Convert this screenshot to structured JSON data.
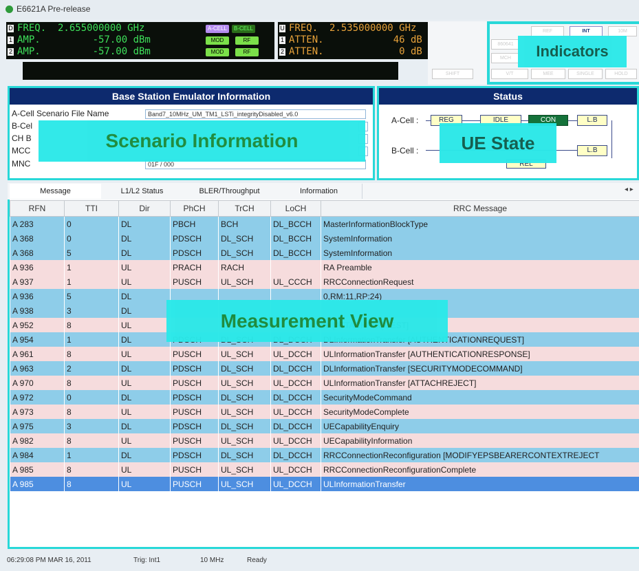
{
  "window": {
    "title": "E6621A Pre-release"
  },
  "led_left": {
    "rows": [
      {
        "index": "D",
        "text": "FREQ.  2.655000000 GHz"
      },
      {
        "index": "1",
        "text": "AMP.         -57.00 dBm"
      },
      {
        "index": "2",
        "text": "AMP.         -57.00 dBm"
      }
    ],
    "buttons": {
      "acell": "A-CELL",
      "bcell": "B-CELL",
      "mod1": "MOD",
      "rf1": "RF",
      "mod2": "MOD",
      "rf2": "RF"
    }
  },
  "led_right": {
    "rows": [
      {
        "index": "U",
        "text": "FREQ.  2.535000000 GHz"
      },
      {
        "index": "1",
        "text": "ATTEN.            46 dB"
      },
      {
        "index": "2",
        "text": "ATTEN.             0 dB"
      }
    ]
  },
  "indicators": {
    "items": [
      "REF",
      "INT",
      "10M",
      "860641",
      "MCH",
      "SHIFT",
      "V/T",
      "MEE",
      "SINGLE",
      "HOLD"
    ],
    "overlay_label": "Indicators"
  },
  "bse": {
    "title": "Base Station Emulator Information",
    "overlay_label": "Scenario Information",
    "labels": {
      "acell_file": "A-Cell Scenario File Name",
      "bcell_file": "B-Cel",
      "ch": "CH B",
      "mcc": "MCC",
      "mnc": "MNC"
    },
    "values": {
      "acell_file": "Band7_10MHz_UM_TM1_LSTi_integrityDisabled_v6.0",
      "mnc": "01F / 000"
    }
  },
  "status_panel": {
    "title": "Status",
    "overlay_label": "UE State",
    "acell_label": "A-Cell :",
    "bcell_label": "B-Cell :",
    "states": {
      "reg": "REG",
      "idle": "IDLE",
      "con": "CON",
      "lb_a": "L.B",
      "lb_b": "L.B",
      "rel": "REL"
    }
  },
  "tabs": [
    "Message",
    "L1/L2 Status",
    "BLER/Throughput",
    "Information"
  ],
  "scroll_arrows": "◂ ▸",
  "table": {
    "headers": [
      "RFN",
      "TTI",
      "Dir",
      "PhCH",
      "TrCH",
      "LoCH",
      "RRC Message"
    ],
    "rows": [
      [
        "A 283",
        "0",
        "DL",
        "PBCH",
        "BCH",
        "DL_BCCH",
        "MasterInformationBlockType"
      ],
      [
        "A 368",
        "0",
        "DL",
        "PDSCH",
        "DL_SCH",
        "DL_BCCH",
        "SystemInformation"
      ],
      [
        "A 368",
        "5",
        "DL",
        "PDSCH",
        "DL_SCH",
        "DL_BCCH",
        "SystemInformation"
      ],
      [
        "A 936",
        "1",
        "UL",
        "PRACH",
        "RACH",
        "",
        "RA Preamble"
      ],
      [
        "A 937",
        "1",
        "UL",
        "PUSCH",
        "UL_SCH",
        "UL_CCCH",
        "RRCConnectionRequest"
      ],
      [
        "A 936",
        "5",
        "DL",
        "",
        "",
        "",
        "0,RM:11,RP:24)"
      ],
      [
        "A 938",
        "3",
        "DL",
        "",
        "",
        "",
        ""
      ],
      [
        "A 952",
        "8",
        "UL",
        "",
        "",
        "",
        "te [ATTACHREQUEST]"
      ],
      [
        "A 954",
        "1",
        "DL",
        "PDSCH",
        "DL_SCH",
        "DL_DCCH",
        "DLInformationTransfer [AUTHENTICATIONREQUEST]"
      ],
      [
        "A 961",
        "8",
        "UL",
        "PUSCH",
        "UL_SCH",
        "UL_DCCH",
        "ULInformationTransfer [AUTHENTICATIONRESPONSE]"
      ],
      [
        "A 963",
        "2",
        "DL",
        "PDSCH",
        "DL_SCH",
        "DL_DCCH",
        "DLInformationTransfer [SECURITYMODECOMMAND]"
      ],
      [
        "A 970",
        "8",
        "UL",
        "PUSCH",
        "UL_SCH",
        "UL_DCCH",
        "ULInformationTransfer [ATTACHREJECT]"
      ],
      [
        "A 972",
        "0",
        "DL",
        "PDSCH",
        "DL_SCH",
        "DL_DCCH",
        "SecurityModeCommand"
      ],
      [
        "A 973",
        "8",
        "UL",
        "PUSCH",
        "UL_SCH",
        "UL_DCCH",
        "SecurityModeComplete"
      ],
      [
        "A 975",
        "3",
        "DL",
        "PDSCH",
        "DL_SCH",
        "DL_DCCH",
        "UECapabilityEnquiry"
      ],
      [
        "A 982",
        "8",
        "UL",
        "PUSCH",
        "UL_SCH",
        "UL_DCCH",
        "UECapabilityInformation"
      ],
      [
        "A 984",
        "1",
        "DL",
        "PDSCH",
        "DL_SCH",
        "DL_DCCH",
        "RRCConnectionReconfiguration [MODIFYEPSBEARERCONTEXTREJECT"
      ],
      [
        "A 985",
        "8",
        "UL",
        "PUSCH",
        "UL_SCH",
        "UL_DCCH",
        "RRCConnectionReconfigurationComplete"
      ],
      [
        "A 985",
        "8",
        "UL",
        "PUSCH",
        "UL_SCH",
        "UL_DCCH",
        "ULInformationTransfer"
      ]
    ],
    "selected_row": 18,
    "overlay_label": "Measurement View"
  },
  "statusbar": {
    "time": "06:29:08 PM MAR 16, 2011",
    "trig": "Trig: Int1",
    "bw": "10 MHz",
    "state": "Ready"
  },
  "colors": {
    "dl_row": "#8ecde9",
    "ul_row": "#f6dcdd",
    "selected_row": "#4d8ee0",
    "overlay": "#2be8e8",
    "panel_header": "#0d2a6e",
    "led_green": "#3ee05a",
    "led_orange": "#e8a23a"
  }
}
